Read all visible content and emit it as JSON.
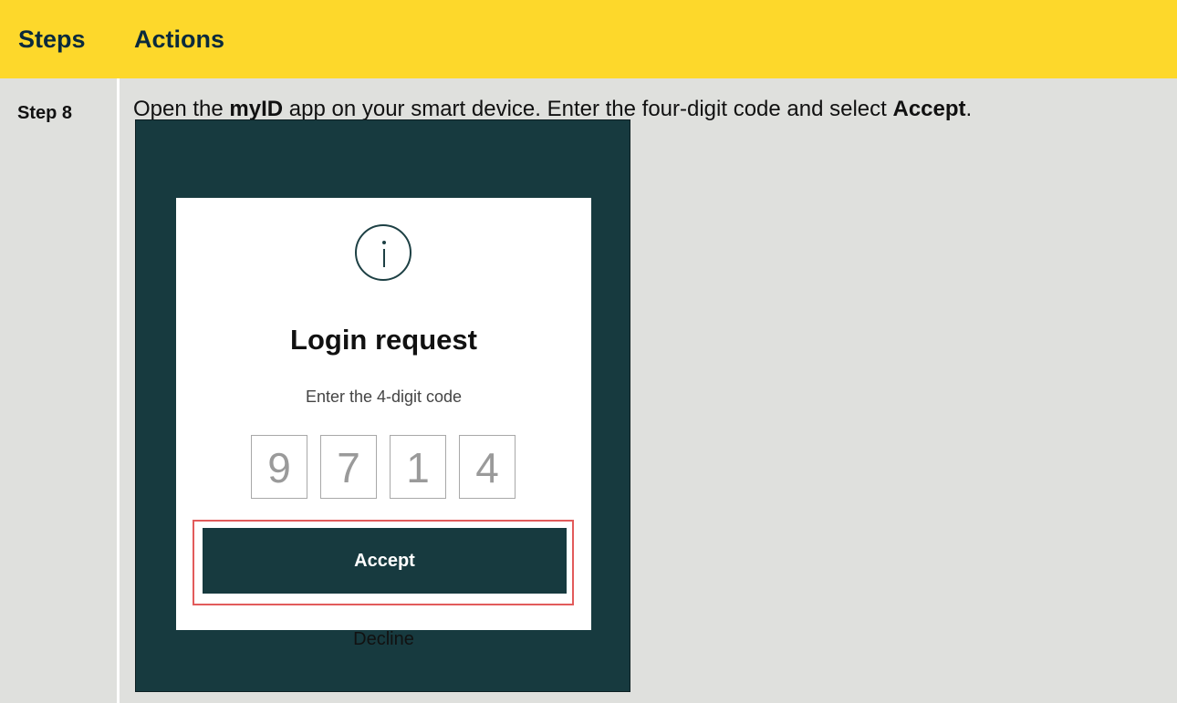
{
  "table": {
    "header": {
      "steps": "Steps",
      "actions": "Actions"
    },
    "row": {
      "step": "Step 8",
      "instruction": {
        "part1": "Open the ",
        "app_name": "myID",
        "part2": " app on your smart device. Enter the four-digit code and select ",
        "action": "Accept",
        "part3": "."
      }
    }
  },
  "phone": {
    "icon": "info-icon",
    "title": "Login request",
    "subtitle": "Enter the 4-digit code",
    "code_digits": [
      "9",
      "7",
      "1",
      "4"
    ],
    "accept_label": "Accept",
    "decline_label": "Decline"
  },
  "colors": {
    "header_bg": "#fdd82b",
    "cell_bg": "#dfe0dd",
    "phone_bg": "#173a3f",
    "highlight": "#e25b5b"
  }
}
